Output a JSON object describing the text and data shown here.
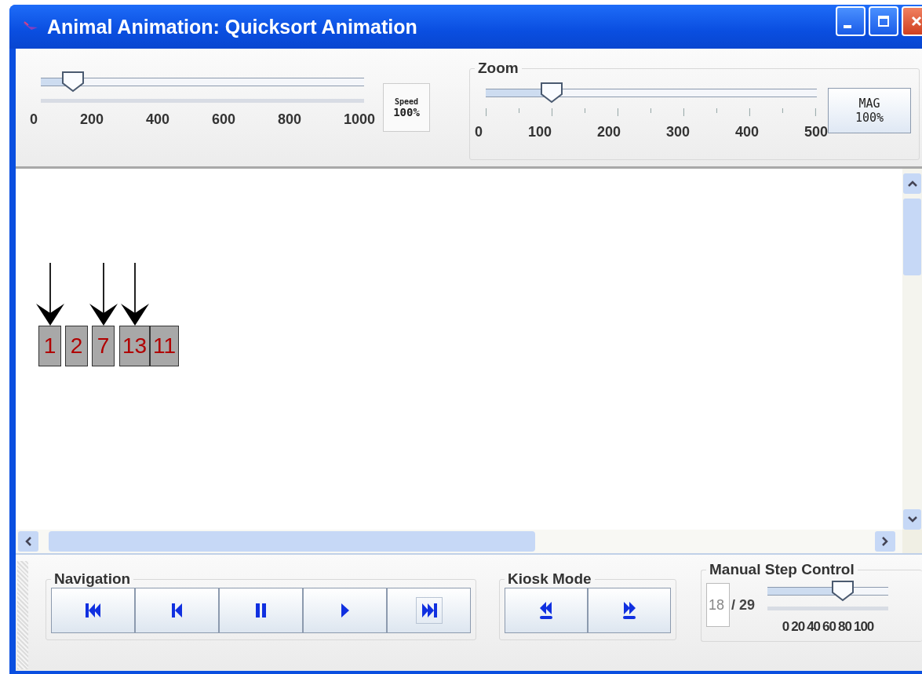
{
  "window": {
    "title": "Animal Animation: Quicksort Animation"
  },
  "speed": {
    "level": 0.1,
    "ticks": [
      "0",
      "200",
      "400",
      "600",
      "800",
      "1000"
    ],
    "button": [
      "Speed",
      "100%"
    ]
  },
  "zoom": {
    "title": "Zoom",
    "level": 0.2,
    "ticks": [
      "0",
      "100",
      "200",
      "300",
      "400",
      "500"
    ],
    "button": [
      "MAG",
      "100%"
    ]
  },
  "cells": [
    {
      "value": "1",
      "pointer": true
    },
    {
      "value": "2",
      "pointer": false
    },
    {
      "value": "7",
      "pointer": true
    },
    {
      "value": "13",
      "pointer": true
    },
    {
      "value": "11",
      "pointer": false
    }
  ],
  "navigation": {
    "title": "Navigation",
    "buttons": [
      {
        "kind": "first",
        "focused": false
      },
      {
        "kind": "back",
        "focused": false
      },
      {
        "kind": "pause",
        "focused": false
      },
      {
        "kind": "play",
        "focused": false
      },
      {
        "kind": "last",
        "focused": true
      }
    ]
  },
  "kiosk": {
    "title": "Kiosk Mode",
    "buttons": [
      {
        "kind": "rewind"
      },
      {
        "kind": "forward"
      }
    ]
  },
  "manual": {
    "title": "Manual Step Control",
    "step": "18",
    "total": "/ 29",
    "level": 0.62,
    "ticks": [
      "0",
      "20",
      "40",
      "60",
      "80",
      "100"
    ]
  }
}
